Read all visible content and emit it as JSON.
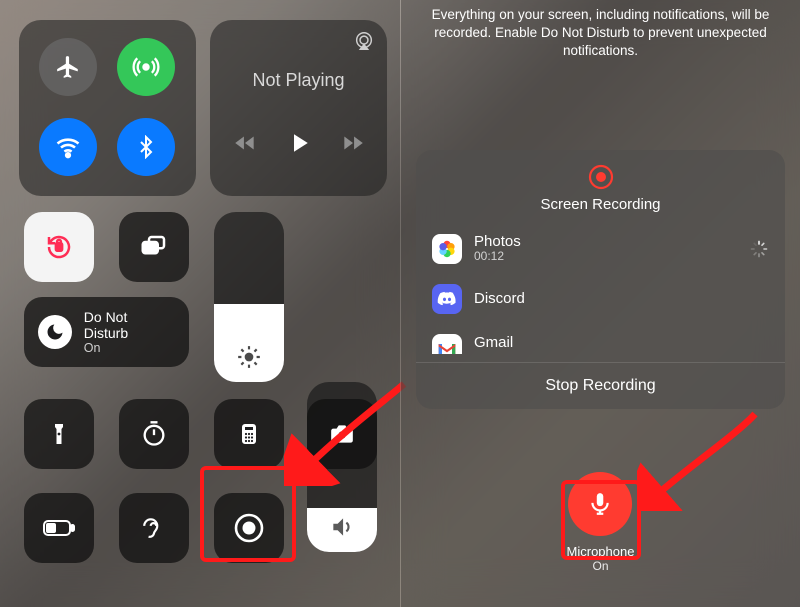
{
  "left": {
    "connectivity": {
      "airplane": "airplane",
      "cellular": "cellular-on",
      "wifi": "wifi-on",
      "bluetooth": "bluetooth-on"
    },
    "nowPlaying": {
      "title": "Not Playing"
    },
    "focus": {
      "label": "Do Not Disturb",
      "status": "On"
    },
    "controls": {
      "rotationLock": "rotation-lock",
      "screenMirroring": "screen-mirroring",
      "flashlight": "flashlight",
      "timer": "timer",
      "calculator": "calculator",
      "camera": "camera",
      "lowPower": "battery",
      "hearing": "hearing",
      "screenRecord": "screen-record"
    }
  },
  "right": {
    "headerText": "Everything on your screen, including notifications, will be recorded. Enable Do Not Disturb to prevent unexpected notifications.",
    "sheetTitle": "Screen Recording",
    "destinations": [
      {
        "name": "Photos",
        "sub": "00:12",
        "icon": "photos",
        "active": true
      },
      {
        "name": "Discord",
        "sub": "",
        "icon": "discord",
        "active": false
      },
      {
        "name": "Gmail",
        "sub": "",
        "icon": "gmail",
        "active": false
      }
    ],
    "stopLabel": "Stop Recording",
    "mic": {
      "label": "Microphone",
      "status": "On"
    }
  }
}
